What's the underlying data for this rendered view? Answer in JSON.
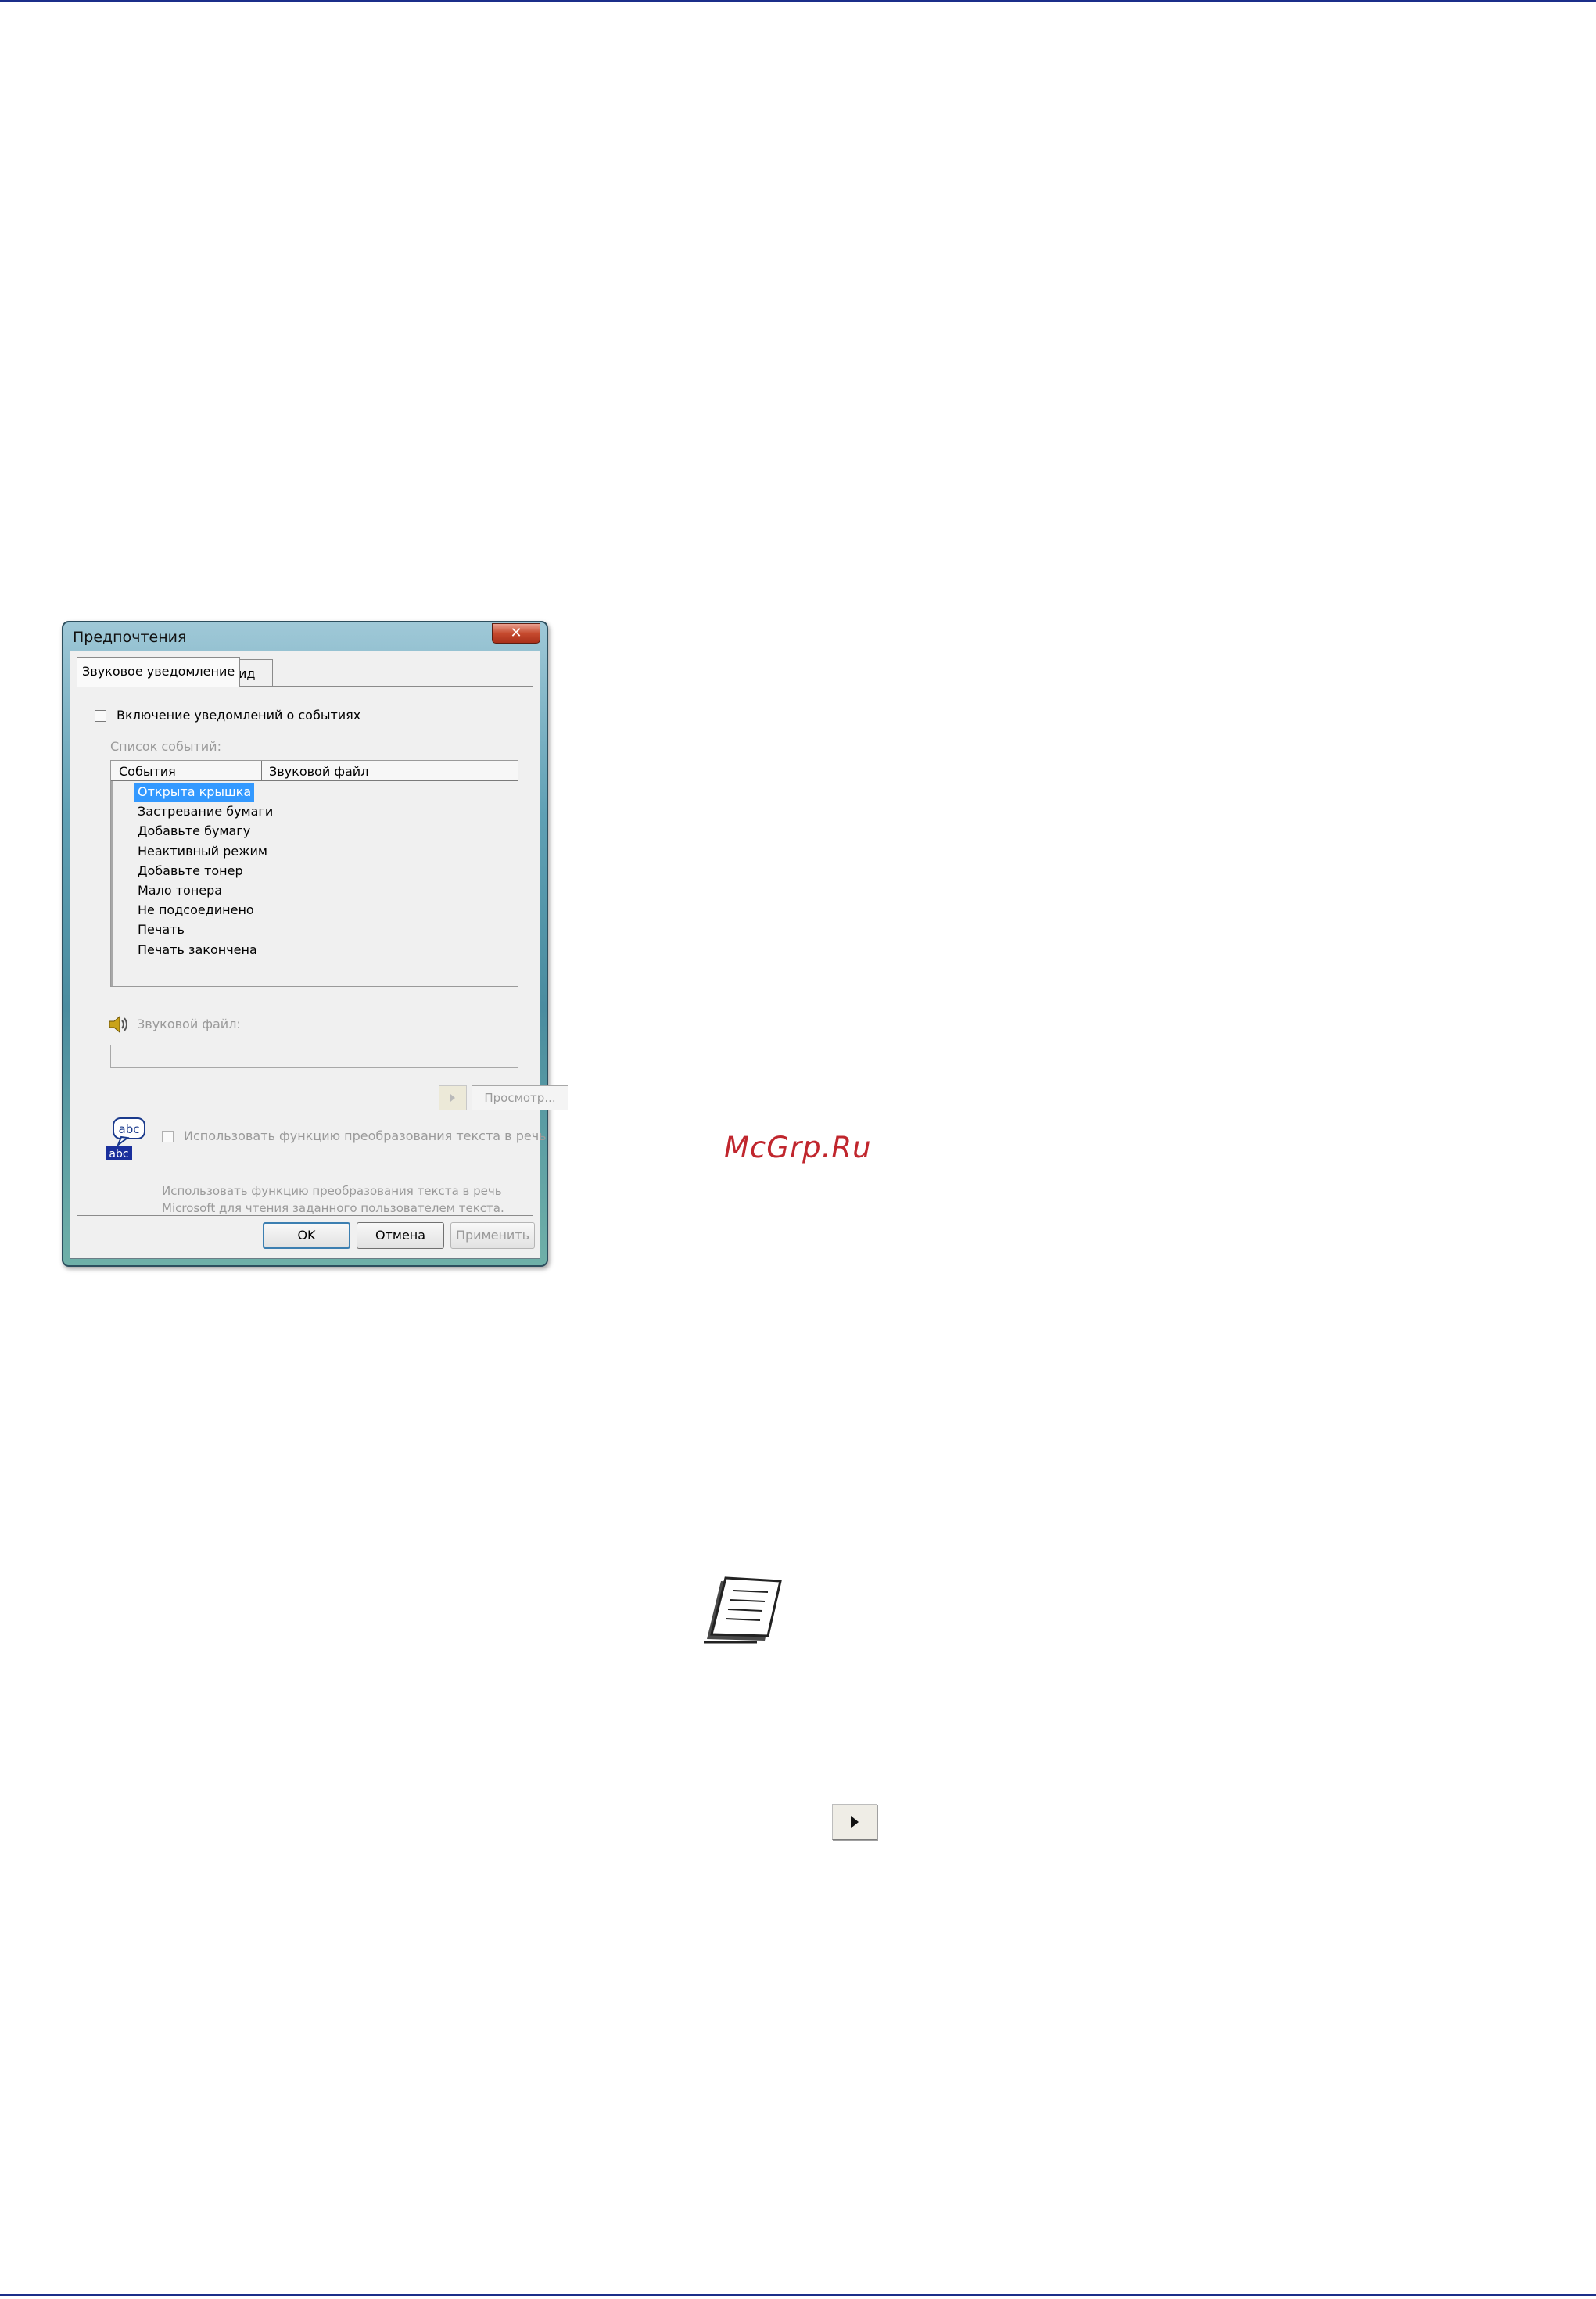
{
  "dialog": {
    "title": "Предпочтения",
    "close_glyph": "✕",
    "tabs": [
      {
        "label": "Звуковое уведомление",
        "active": true
      },
      {
        "label": "Вид",
        "active": false
      }
    ],
    "enable_checkbox_label": "Включение уведомлений о событиях",
    "event_list_label": "Список событий:",
    "columns": [
      "События",
      "Звуковой файл"
    ],
    "events": [
      "Открыта крышка",
      "Застревание бумаги",
      "Добавьте бумагу",
      "Неактивный режим",
      "Добавьте тонер",
      "Мало тонера",
      "Не подсоединено",
      "Печать",
      "Печать закончена"
    ],
    "selected_event": "Открыта крышка",
    "sound_file_label": "Звуковой файл:",
    "sound_file_value": "",
    "browse_label": "Просмотр...",
    "tts_icon_text_top": "abc",
    "tts_icon_text_bottom": "abc",
    "tts_checkbox_label": "Использовать функцию преобразования текста в речь",
    "tts_description_line1": "Использовать функцию преобразования текста в речь",
    "tts_description_line2": "Microsoft для чтения заданного пользователем текста.",
    "buttons": {
      "ok": "OK",
      "cancel": "Отмена",
      "apply": "Применить"
    }
  },
  "watermark": "McGrp.Ru",
  "colors": {
    "rule": "#1b2e8a",
    "selection": "#3399ff",
    "watermark": "#c0262d",
    "disabled_text": "#9a9a9a"
  },
  "icons": [
    "speaker-icon",
    "text-to-speech-icon",
    "note-icon",
    "play-icon"
  ]
}
